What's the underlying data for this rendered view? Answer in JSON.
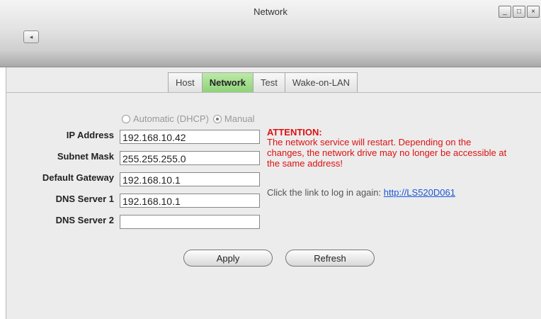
{
  "window": {
    "title": "Network",
    "back_glyph": "◂",
    "controls": {
      "minimize": "_",
      "maximize": "□",
      "close": "×"
    }
  },
  "tabs": [
    {
      "label": "Host",
      "active": false
    },
    {
      "label": "Network",
      "active": true
    },
    {
      "label": "Test",
      "active": false
    },
    {
      "label": "Wake-on-LAN",
      "active": false
    }
  ],
  "mode": {
    "options": [
      "Automatic (DHCP)",
      "Manual"
    ],
    "selected": "Manual"
  },
  "fields": [
    {
      "label": "IP Address",
      "value": "192.168.10.42"
    },
    {
      "label": "Subnet Mask",
      "value": "255.255.255.0"
    },
    {
      "label": "Default Gateway",
      "value": "192.168.10.1"
    },
    {
      "label": "DNS Server 1",
      "value": "192.168.10.1"
    },
    {
      "label": "DNS Server 2",
      "value": ""
    }
  ],
  "notice": {
    "title": "ATTENTION:",
    "body": "The network service will restart. Depending on the changes, the network drive may no longer be accessible at the same address!",
    "relogin_text": "Click the link to log in again:",
    "relogin_link": "http://LS520D061"
  },
  "buttons": {
    "apply": "Apply",
    "refresh": "Refresh"
  },
  "colors": {
    "active_tab": "#9fdc88",
    "warning": "#dd1111",
    "link": "#1a55d6"
  }
}
